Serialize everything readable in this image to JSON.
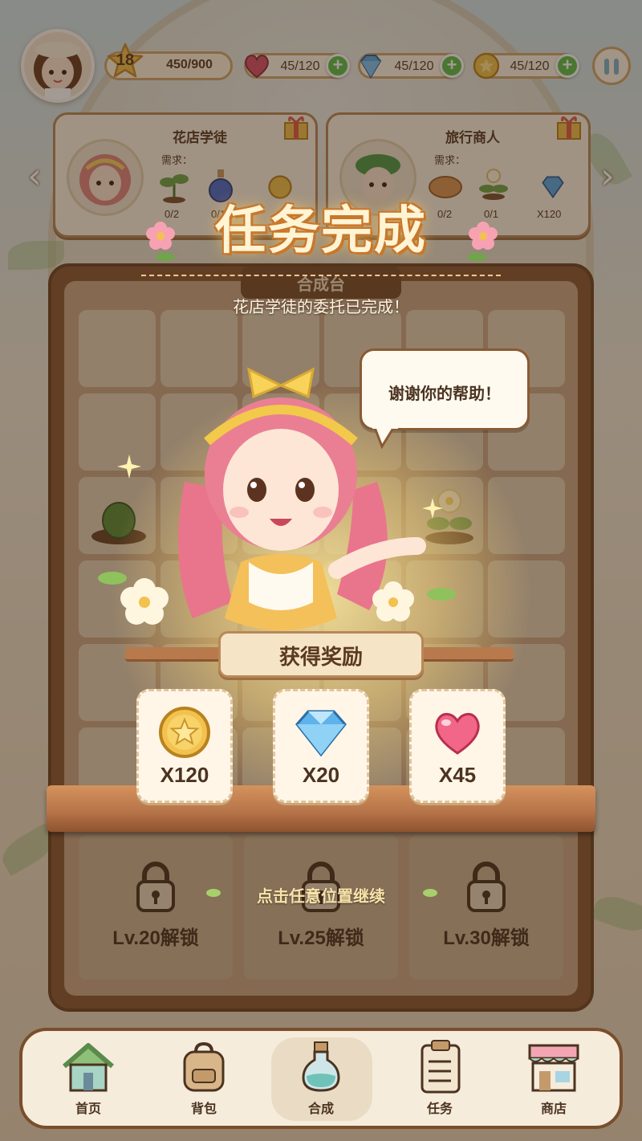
{
  "player": {
    "level": "18",
    "xp": "450/900"
  },
  "resources": {
    "hearts": "45/120",
    "gems": "45/120",
    "coins": "45/120"
  },
  "orders": [
    {
      "title": "花店学徒",
      "need_label": "需求：",
      "progress": [
        "0/2",
        "0/1"
      ]
    },
    {
      "title": "旅行商人",
      "need_label": "需求：",
      "progress": [
        "0/2",
        "0/1"
      ],
      "reward": "X120"
    }
  ],
  "board": {
    "title": "合成台",
    "locked_slots": [
      "Lv.20解锁",
      "Lv.25解锁",
      "Lv.30解锁"
    ]
  },
  "popup": {
    "title": "任务完成",
    "message": "花店学徒的委托已完成！",
    "speech": "谢谢你的帮助！",
    "reward_title": "获得奖励",
    "rewards": [
      {
        "icon": "coin-icon",
        "amount": "X120"
      },
      {
        "icon": "diamond-icon",
        "amount": "X20"
      },
      {
        "icon": "heart-icon",
        "amount": "X45"
      }
    ],
    "continue_hint": "点击任意位置继续"
  },
  "nav": {
    "items": [
      "首页",
      "背包",
      "合成",
      "任务",
      "商店"
    ],
    "active": "合成"
  },
  "colors": {
    "accent_green": "#5fbf4a",
    "wood": "#8a5a34",
    "gold_text": "#f9e3a8"
  }
}
